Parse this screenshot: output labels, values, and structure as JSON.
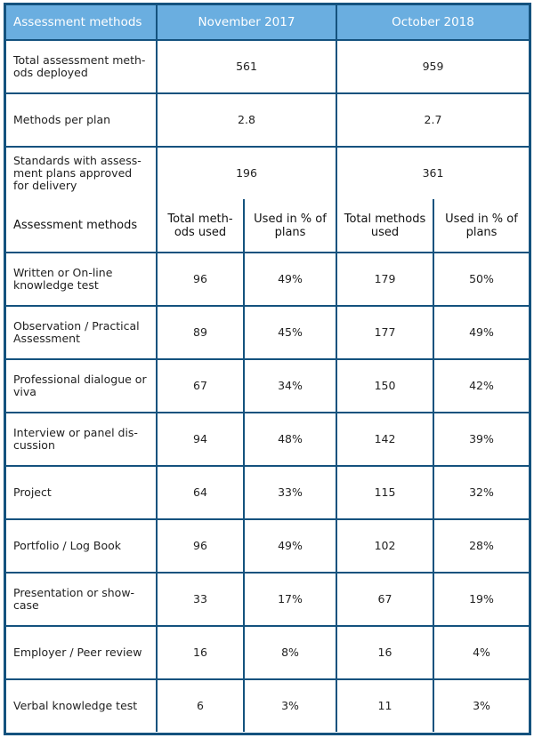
{
  "summary": {
    "headers": [
      "Assessment methods",
      "November 2017",
      "October 2018"
    ],
    "rows": [
      {
        "label": "Total assessment meth-ods deployed",
        "nov2017": "561",
        "oct2018": "959"
      },
      {
        "label": "Methods per plan",
        "nov2017": "2.8",
        "oct2018": "2.7"
      },
      {
        "label": "Standards with assess-ment plans approved for delivery",
        "nov2017": "196",
        "oct2018": "361"
      }
    ]
  },
  "methods": {
    "headers": [
      "Assessment methods",
      "Total meth-ods used",
      "Used in % of plans",
      "Total methods used",
      "Used in % of plans"
    ],
    "rows": [
      {
        "label": "Written or On-line knowledge test",
        "nov_total": "96",
        "nov_pct": "49%",
        "oct_total": "179",
        "oct_pct": "50%"
      },
      {
        "label": "Observation / Practical Assessment",
        "nov_total": "89",
        "nov_pct": "45%",
        "oct_total": "177",
        "oct_pct": "49%"
      },
      {
        "label": "Professional dialogue or viva",
        "nov_total": "67",
        "nov_pct": "34%",
        "oct_total": "150",
        "oct_pct": "42%"
      },
      {
        "label": "Interview or panel dis-cussion",
        "nov_total": "94",
        "nov_pct": "48%",
        "oct_total": "142",
        "oct_pct": "39%"
      },
      {
        "label": "Project",
        "nov_total": "64",
        "nov_pct": "33%",
        "oct_total": "115",
        "oct_pct": "32%"
      },
      {
        "label": "Portfolio / Log Book",
        "nov_total": "96",
        "nov_pct": "49%",
        "oct_total": "102",
        "oct_pct": "28%"
      },
      {
        "label": "Presentation or show-case",
        "nov_total": "33",
        "nov_pct": "17%",
        "oct_total": "67",
        "oct_pct": "19%"
      },
      {
        "label": "Employer / Peer review",
        "nov_total": "16",
        "nov_pct": "8%",
        "oct_total": "16",
        "oct_pct": "4%"
      },
      {
        "label": "Verbal knowledge test",
        "nov_total": "6",
        "nov_pct": "3%",
        "oct_total": "11",
        "oct_pct": "3%"
      }
    ]
  },
  "colors": {
    "header_bg": "#6aaee0",
    "border": "#14527e",
    "header_text": "#ffffff"
  }
}
